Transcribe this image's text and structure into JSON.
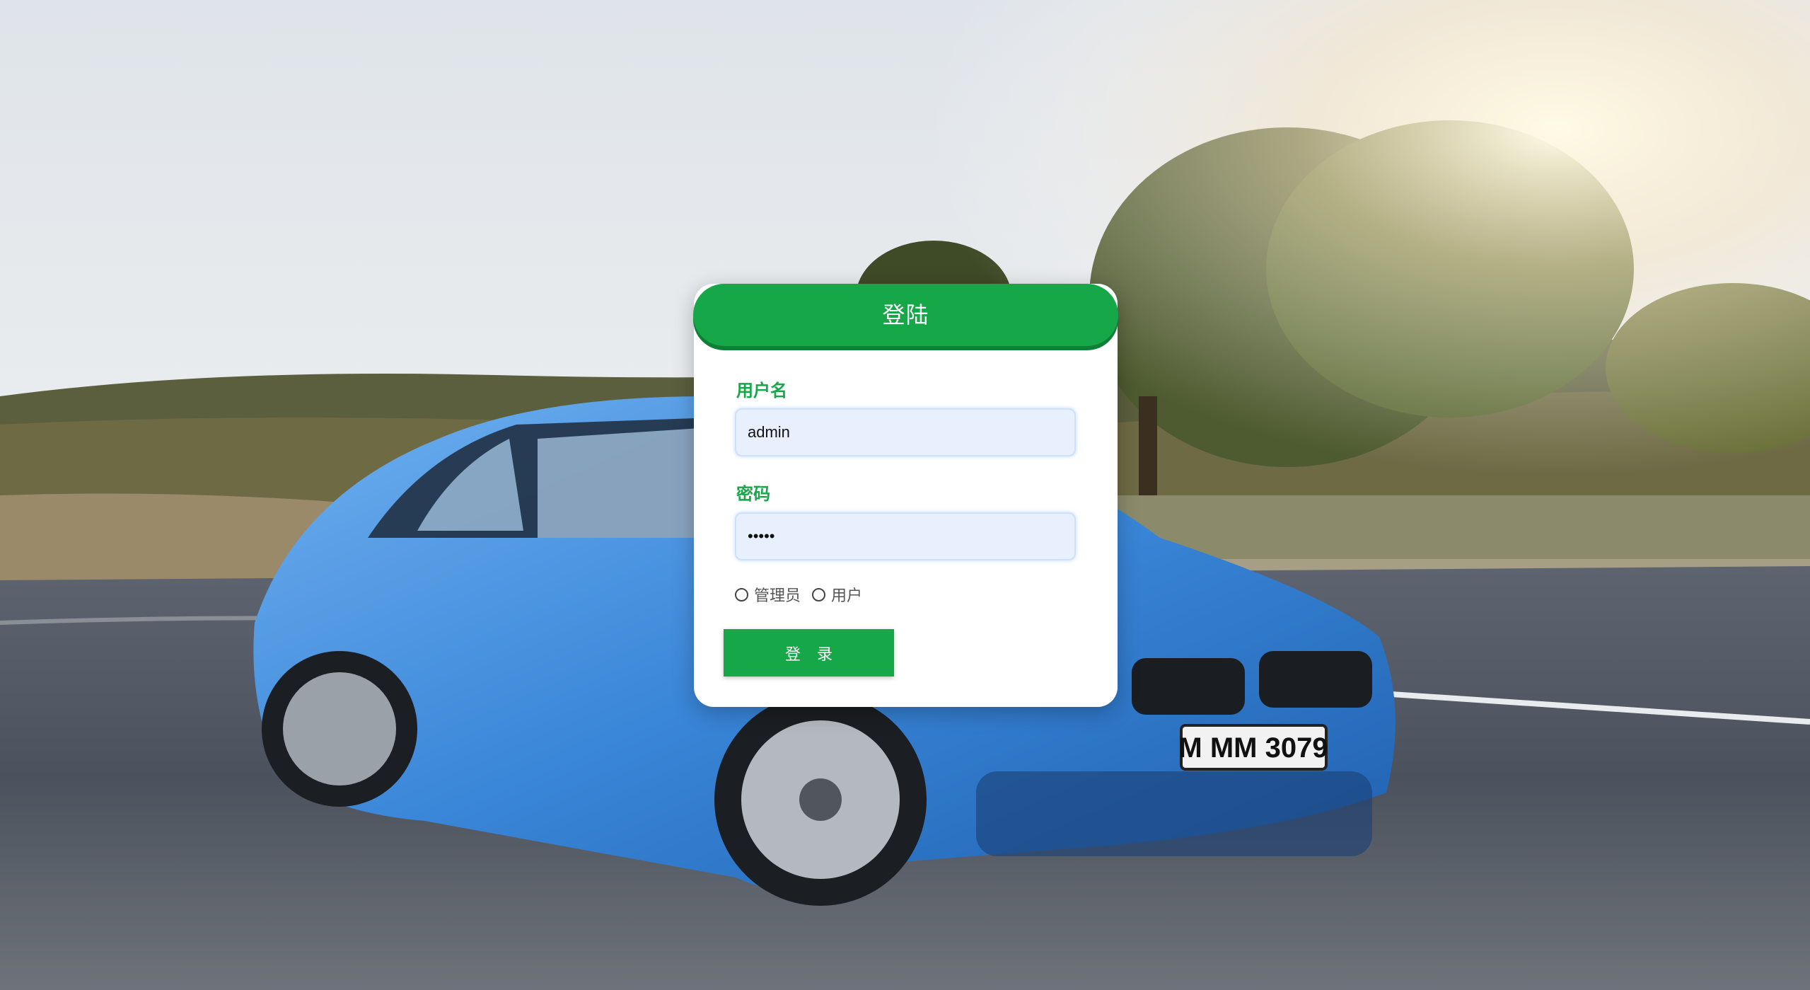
{
  "login": {
    "title": "登陆",
    "username_label": "用户名",
    "username_value": "admin",
    "password_label": "密码",
    "password_value": "•••••",
    "roles": [
      "管理员",
      "用户"
    ],
    "submit_label": "登 录"
  },
  "colors": {
    "accent": "#16a748",
    "input_bg": "#e8f0fe"
  }
}
